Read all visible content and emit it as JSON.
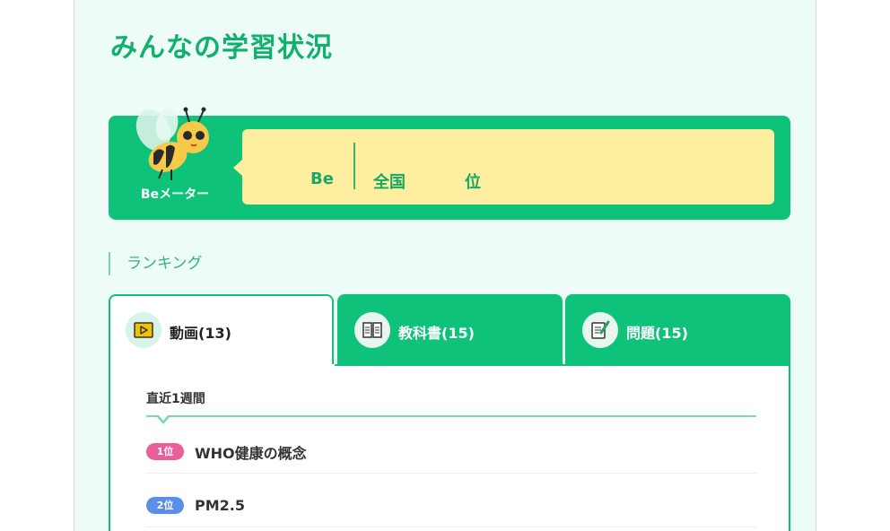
{
  "page": {
    "title": "みんなの学習状況"
  },
  "be_meter": {
    "label": "Beメーター",
    "be_text": "Be",
    "national_text": "全国",
    "rank_suffix": "位",
    "colors": {
      "panel": "#0fc27a",
      "bubble": "#fdef9f",
      "text": "#16a865"
    }
  },
  "ranking": {
    "heading": "ランキング",
    "tabs": [
      {
        "label": "動画(13)",
        "icon": "video-play-icon",
        "active": true
      },
      {
        "label": "教科書(15)",
        "icon": "book-icon",
        "active": false
      },
      {
        "label": "問題(15)",
        "icon": "quiz-pencil-icon",
        "active": false
      }
    ],
    "period": "直近1週間",
    "items": [
      {
        "rank": "1位",
        "title": "WHO健康の概念",
        "badge_color": "#e95f9c"
      },
      {
        "rank": "2位",
        "title": "PM2.5",
        "badge_color": "#5b8ee8"
      }
    ]
  }
}
